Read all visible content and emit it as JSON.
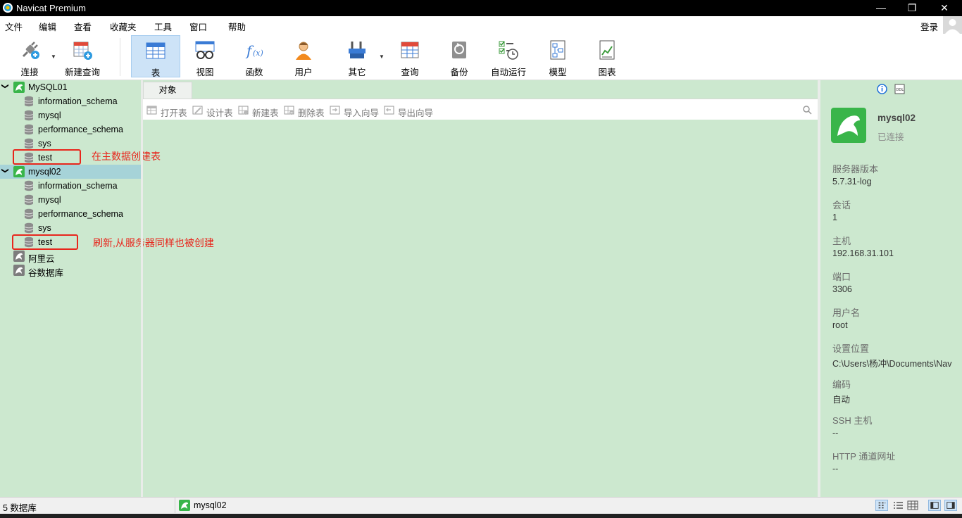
{
  "window": {
    "title": "Navicat Premium",
    "controls": {
      "minimize": "—",
      "restore": "❐",
      "close": "✕"
    }
  },
  "menu": {
    "items": [
      "文件",
      "编辑",
      "查看",
      "收藏夹",
      "工具",
      "窗口",
      "帮助"
    ],
    "login": "登录"
  },
  "toolbar": {
    "connect": "连接",
    "new_query": "新建查询",
    "table": "表",
    "view": "视图",
    "function": "函数",
    "user": "用户",
    "other": "其它",
    "query": "查询",
    "backup": "备份",
    "automation": "自动运行",
    "model": "模型",
    "chart": "图表"
  },
  "tree": {
    "conn1": {
      "name": "MySQL01",
      "databases": [
        "information_schema",
        "mysql",
        "performance_schema",
        "sys",
        "test"
      ]
    },
    "conn2": {
      "name": "mysql02",
      "databases": [
        "information_schema",
        "mysql",
        "performance_schema",
        "sys",
        "test"
      ]
    },
    "conn3": {
      "name": "阿里云"
    },
    "conn4": {
      "name": "谷数据库"
    }
  },
  "annotations": {
    "note1": "在主数据创建表",
    "note2": "刷新,从服务器同样也被创建"
  },
  "main": {
    "tab": "对象",
    "actions": {
      "open": "打开表",
      "design": "设计表",
      "new": "新建表",
      "delete": "删除表",
      "import": "导入向导",
      "export": "导出向导"
    }
  },
  "info": {
    "name": "mysql02",
    "status": "已连接",
    "server_version_label": "服务器版本",
    "server_version": "5.7.31-log",
    "session_label": "会话",
    "session": "1",
    "host_label": "主机",
    "host": "192.168.31.101",
    "port_label": "端口",
    "port": "3306",
    "user_label": "用户名",
    "user": "root",
    "location_label": "设置位置",
    "location": "C:\\Users\\杨冲\\Documents\\Nav",
    "encoding_label": "编码",
    "encoding": "自动",
    "ssh_label": "SSH 主机",
    "ssh": "--",
    "http_label": "HTTP 通道网址",
    "http": "--"
  },
  "status": {
    "count": "5 数据库",
    "connection": "mysql02"
  },
  "colors": {
    "accent_red": "#e8261c",
    "background": "#cce8cf",
    "selected": "#a6d3d8",
    "mysql_green": "#39b54a"
  }
}
